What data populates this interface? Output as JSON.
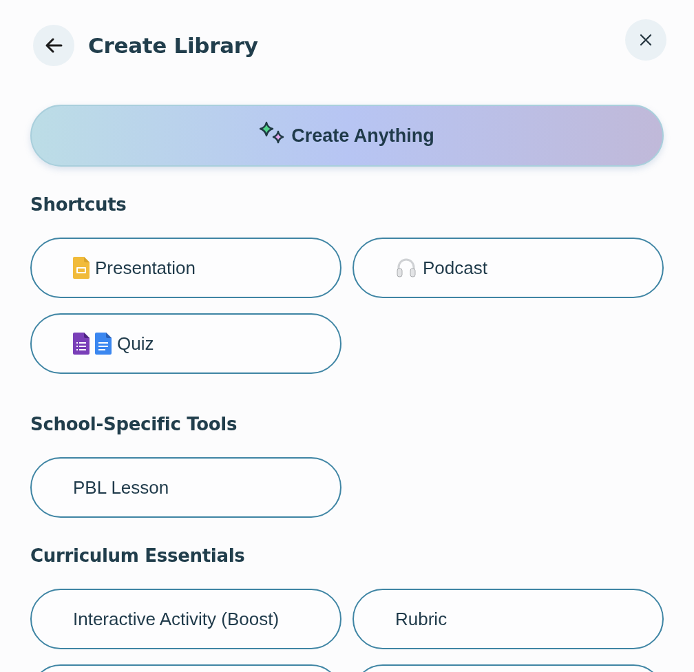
{
  "header": {
    "title": "Create Library"
  },
  "create_button": {
    "label": "Create Anything"
  },
  "sections": [
    {
      "heading": "Shortcuts",
      "items": [
        {
          "label": "Presentation",
          "kind": "slides"
        },
        {
          "label": "Podcast",
          "kind": "podcast"
        },
        {
          "label": "Quiz",
          "kind": "quiz"
        }
      ]
    },
    {
      "heading": "School-Specific Tools",
      "items": [
        {
          "label": "PBL Lesson",
          "kind": "plain"
        }
      ]
    },
    {
      "heading": "Curriculum Essentials",
      "continues": true,
      "items": [
        {
          "label": "Interactive Activity (Boost)",
          "kind": "plain"
        },
        {
          "label": "Rubric",
          "kind": "plain"
        }
      ]
    }
  ]
}
